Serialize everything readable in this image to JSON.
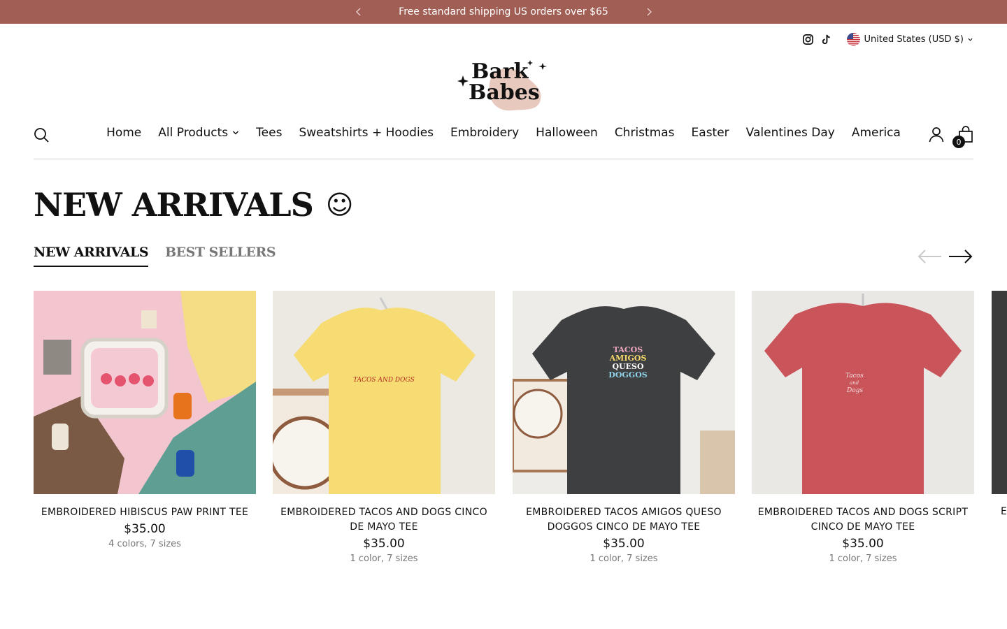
{
  "announcement": {
    "text": "Free standard shipping US orders over $65",
    "bg_color": "#a15e55"
  },
  "utility": {
    "social": [
      {
        "name": "instagram-icon"
      },
      {
        "name": "tiktok-icon"
      }
    ],
    "currency_label": "United States (USD $)"
  },
  "logo": {
    "line1": "Bark",
    "line2": "Babes"
  },
  "nav": {
    "items": [
      {
        "label": "Home"
      },
      {
        "label": "All Products",
        "has_dropdown": true
      },
      {
        "label": "Tees"
      },
      {
        "label": "Sweatshirts + Hoodies"
      },
      {
        "label": "Embroidery"
      },
      {
        "label": "Halloween"
      },
      {
        "label": "Christmas"
      },
      {
        "label": "Easter"
      },
      {
        "label": "Valentines Day"
      },
      {
        "label": "America"
      }
    ],
    "cart_count": "0"
  },
  "section": {
    "heading": "NEW ARRIVALS",
    "heading_emoji": "☺",
    "tabs": [
      {
        "label": "NEW ARRIVALS",
        "active": true
      },
      {
        "label": "BEST SELLERS",
        "active": false
      }
    ]
  },
  "products": [
    {
      "title": "EMBROIDERED HIBISCUS PAW PRINT TEE",
      "price": "$35.00",
      "variants": "4 colors, 7 sizes"
    },
    {
      "title": "EMBROIDERED TACOS AND DOGS CINCO DE MAYO TEE",
      "price": "$35.00",
      "variants": "1 color, 7 sizes",
      "print_text": "TACOS AND DOGS"
    },
    {
      "title": "EMBROIDERED TACOS AMIGOS QUESO DOGGOS CINCO DE MAYO TEE",
      "price": "$35.00",
      "variants": "1 color, 7 sizes",
      "print_lines": [
        "TACOS",
        "AMIGOS",
        "QUESO",
        "DOGGOS"
      ]
    },
    {
      "title": "EMBROIDERED TACOS AND DOGS SCRIPT CINCO DE MAYO TEE",
      "price": "$35.00",
      "variants": "1 color, 7 sizes",
      "print_lines": [
        "Tacos",
        "and",
        "Dogs"
      ]
    }
  ],
  "peek_title": "E"
}
